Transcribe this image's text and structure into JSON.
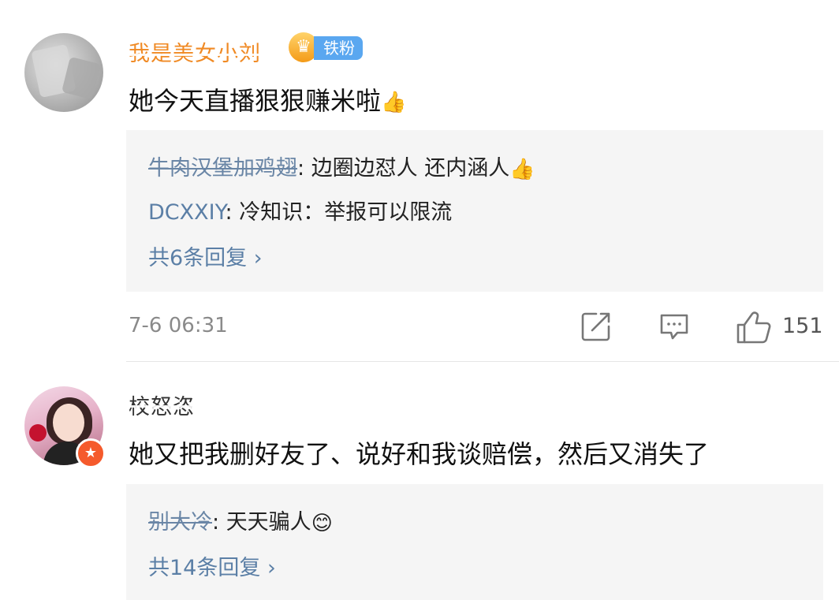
{
  "comments": [
    {
      "username": "我是美女小刘",
      "badge_label": "铁粉",
      "text": "她今天直播狠狠赚米啦",
      "text_emoji": "👍",
      "replies": [
        {
          "name": "牛肉汉堡加鸡翅",
          "text": "边圈边怼人 还内涵人",
          "emoji": "👍"
        },
        {
          "name": "DCXXIY",
          "text": "冷知识：举报可以限流",
          "emoji": ""
        }
      ],
      "more_replies": "共6条回复 ›",
      "timestamp": "7-6 06:31",
      "like_count": "151",
      "icons": [
        "forward-icon",
        "comment-icon",
        "like-icon"
      ]
    },
    {
      "username": "校怒恣",
      "text": "她又把我删好友了、说好和我谈赔偿，然后又消失了",
      "replies": [
        {
          "name": "别大冷",
          "text": "天天骗人",
          "emoji": "😊"
        }
      ],
      "more_replies": "共14条回复 ›"
    }
  ],
  "colors": {
    "link": "#5b7fa6",
    "fan_badge": "#5aa7f0",
    "crown": "#f49b18",
    "username_highlight": "#f08a24",
    "reply_bg": "#f5f5f5",
    "verify_badge": "#f55a2c"
  }
}
